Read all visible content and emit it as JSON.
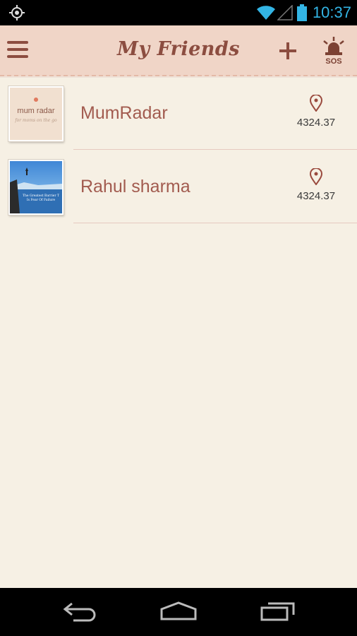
{
  "status_bar": {
    "time": "10:37",
    "icons": [
      "gps-icon",
      "wifi-icon",
      "signal-icon",
      "battery-icon"
    ],
    "accent_color": "#33b5e5"
  },
  "header": {
    "title": "My Friends",
    "sos_label": "SOS",
    "background_color": "#f0d5c7",
    "title_color": "#8c4d40"
  },
  "friends": [
    {
      "name": "MumRadar",
      "distance": "4324.37",
      "thumbnail": "mumradar-logo"
    },
    {
      "name": "Rahul sharma",
      "distance": "4324.37",
      "thumbnail": "lake-photo"
    }
  ],
  "thumbnail_text": {
    "mumradar_logo": "mum radar",
    "mumradar_tagline": "for moms on the go",
    "photo_caption_line1": "The Greatest Barrier T",
    "photo_caption_line2": "Is Fear Of Failure"
  },
  "nav_bar": {
    "icons": [
      "back-icon",
      "home-icon",
      "recent-apps-icon"
    ]
  }
}
